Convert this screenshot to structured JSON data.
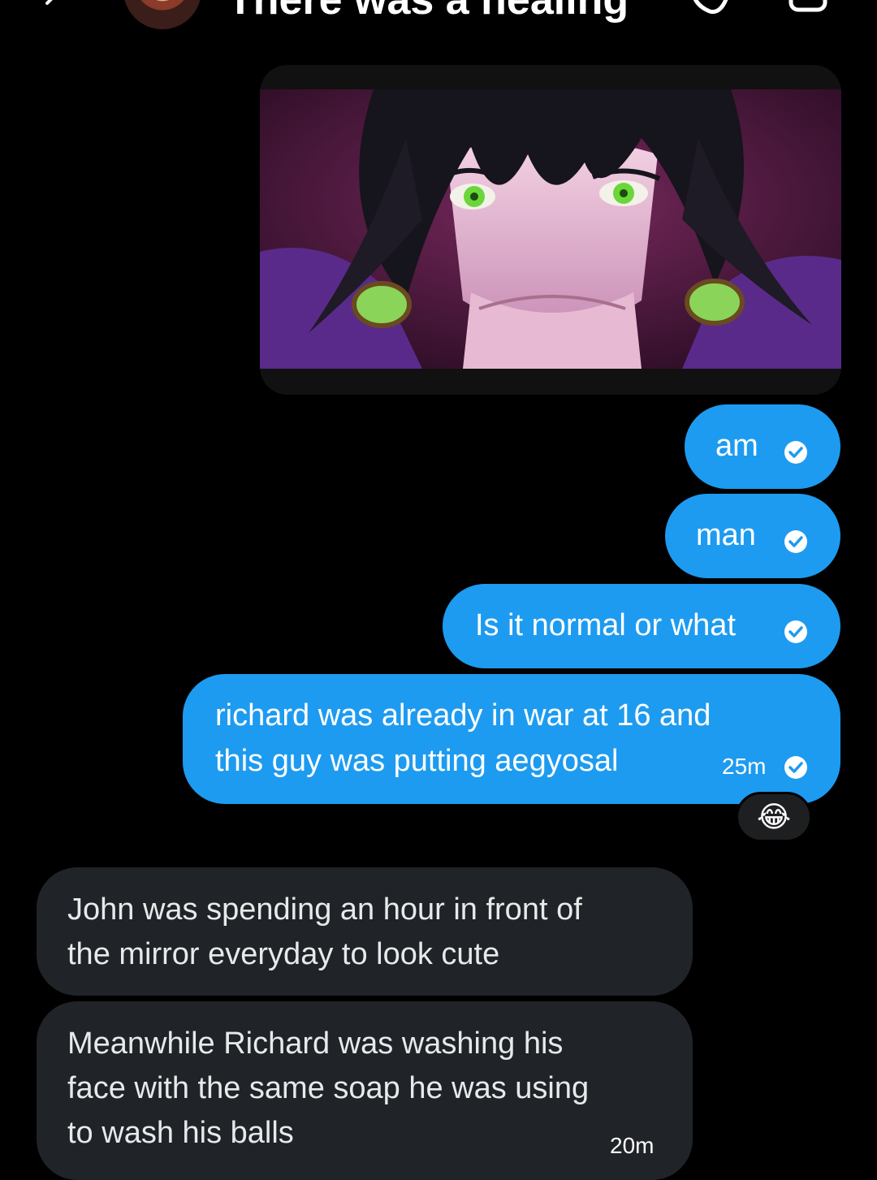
{
  "header": {
    "title": "There was a healing"
  },
  "messages": {
    "outgoing": [
      {
        "text": "am"
      },
      {
        "text": "man"
      },
      {
        "text": "Is it normal or what"
      },
      {
        "line1": "richard was already in war at 16 and",
        "line2": "this guy was putting aegyosal",
        "time": "25m"
      }
    ],
    "reaction": "😂",
    "incoming": [
      {
        "line1": "John was spending an hour in front of",
        "line2": "the mirror everyday to look cute"
      },
      {
        "line1": "Meanwhile Richard was washing his",
        "line2": "face with the same soap he was using",
        "line3": "to wash his balls",
        "time": "20m"
      }
    ]
  },
  "colors": {
    "outgoing_bubble": "#1d9bf0",
    "incoming_bubble": "#202327",
    "background": "#000000"
  },
  "icons": [
    "back-arrow-icon",
    "call-icon",
    "video-icon",
    "check-icon"
  ]
}
